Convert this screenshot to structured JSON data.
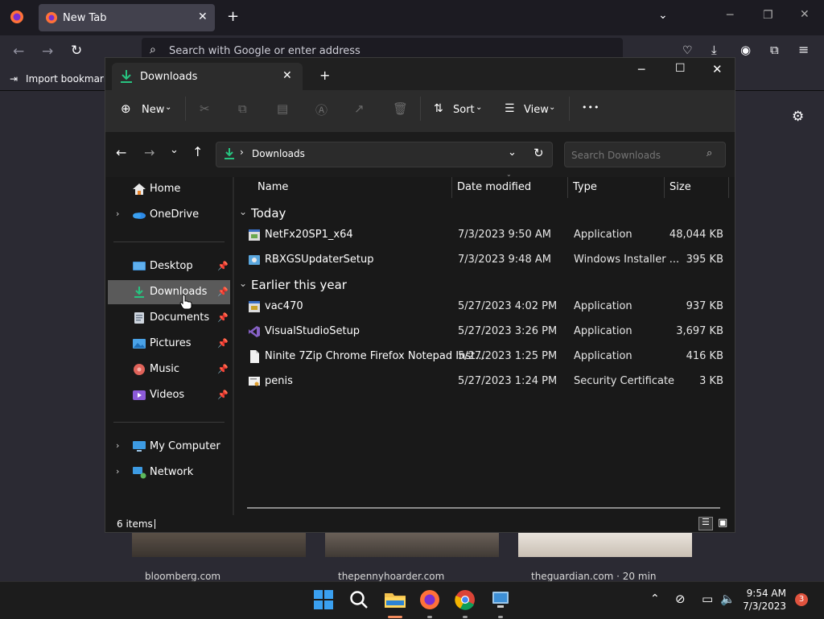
{
  "browser": {
    "tab_title": "New Tab",
    "url_placeholder": "Search with Google or enter address",
    "bookmark_label": "Import bookmarks",
    "thumbnails": [
      {
        "label": "bloomberg.com"
      },
      {
        "label": "thepennyhoarder.com"
      },
      {
        "label": "theguardian.com · 20 min"
      }
    ]
  },
  "explorer": {
    "tab_title": "Downloads",
    "toolbar": {
      "new_label": "New",
      "sort_label": "Sort",
      "view_label": "View",
      "more_label": "•••"
    },
    "address": {
      "path": "Downloads"
    },
    "search": {
      "placeholder": "Search Downloads"
    },
    "nav": {
      "quick": [
        {
          "label": "Home",
          "icon": "home-icon"
        },
        {
          "label": "OneDrive",
          "icon": "onedrive-icon"
        }
      ],
      "pinned": [
        {
          "label": "Desktop",
          "icon": "desktop-icon"
        },
        {
          "label": "Downloads",
          "icon": "downloads-icon"
        },
        {
          "label": "Documents",
          "icon": "documents-icon"
        },
        {
          "label": "Pictures",
          "icon": "pictures-icon"
        },
        {
          "label": "Music",
          "icon": "music-icon"
        },
        {
          "label": "Videos",
          "icon": "videos-icon"
        }
      ],
      "devices": [
        {
          "label": "My Computer",
          "icon": "computer-icon"
        },
        {
          "label": "Network",
          "icon": "network-icon"
        }
      ]
    },
    "columns": {
      "name": "Name",
      "date": "Date modified",
      "type": "Type",
      "size": "Size"
    },
    "groups": [
      {
        "label": "Today",
        "files": [
          {
            "name": "NetFx20SP1_x64",
            "date": "7/3/2023 9:50 AM",
            "type": "Application",
            "size": "48,044 KB"
          },
          {
            "name": "RBXGSUpdaterSetup",
            "date": "7/3/2023 9:48 AM",
            "type": "Windows Installer ...",
            "size": "395 KB"
          }
        ]
      },
      {
        "label": "Earlier this year",
        "files": [
          {
            "name": "vac470",
            "date": "5/27/2023 4:02 PM",
            "type": "Application",
            "size": "937 KB"
          },
          {
            "name": "VisualStudioSetup",
            "date": "5/27/2023 3:26 PM",
            "type": "Application",
            "size": "3,697 KB"
          },
          {
            "name": "Ninite 7Zip Chrome Firefox Notepad Inst...",
            "date": "5/27/2023 1:25 PM",
            "type": "Application",
            "size": "416 KB"
          },
          {
            "name": "penis",
            "date": "5/27/2023 1:24 PM",
            "type": "Security Certificate",
            "size": "3 KB"
          }
        ]
      }
    ],
    "status": "6 items"
  },
  "taskbar": {
    "time": "9:54 AM",
    "date": "7/3/2023",
    "notification_count": "3"
  },
  "colors": {
    "accent": "#0078d4",
    "folder": "#f2c14e",
    "download_green": "#27c480"
  }
}
